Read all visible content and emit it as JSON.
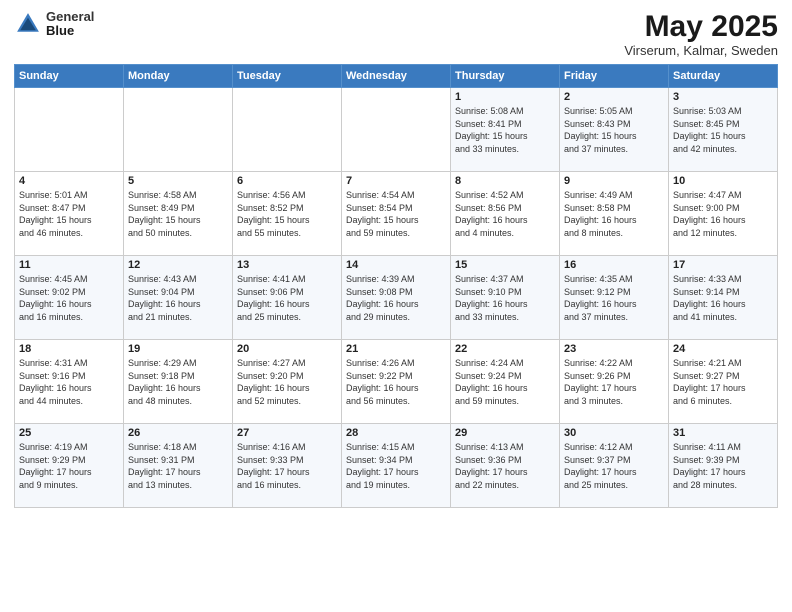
{
  "header": {
    "logo_line1": "General",
    "logo_line2": "Blue",
    "month": "May 2025",
    "location": "Virserum, Kalmar, Sweden"
  },
  "weekdays": [
    "Sunday",
    "Monday",
    "Tuesday",
    "Wednesday",
    "Thursday",
    "Friday",
    "Saturday"
  ],
  "weeks": [
    [
      {
        "day": "",
        "info": ""
      },
      {
        "day": "",
        "info": ""
      },
      {
        "day": "",
        "info": ""
      },
      {
        "day": "",
        "info": ""
      },
      {
        "day": "1",
        "info": "Sunrise: 5:08 AM\nSunset: 8:41 PM\nDaylight: 15 hours\nand 33 minutes."
      },
      {
        "day": "2",
        "info": "Sunrise: 5:05 AM\nSunset: 8:43 PM\nDaylight: 15 hours\nand 37 minutes."
      },
      {
        "day": "3",
        "info": "Sunrise: 5:03 AM\nSunset: 8:45 PM\nDaylight: 15 hours\nand 42 minutes."
      }
    ],
    [
      {
        "day": "4",
        "info": "Sunrise: 5:01 AM\nSunset: 8:47 PM\nDaylight: 15 hours\nand 46 minutes."
      },
      {
        "day": "5",
        "info": "Sunrise: 4:58 AM\nSunset: 8:49 PM\nDaylight: 15 hours\nand 50 minutes."
      },
      {
        "day": "6",
        "info": "Sunrise: 4:56 AM\nSunset: 8:52 PM\nDaylight: 15 hours\nand 55 minutes."
      },
      {
        "day": "7",
        "info": "Sunrise: 4:54 AM\nSunset: 8:54 PM\nDaylight: 15 hours\nand 59 minutes."
      },
      {
        "day": "8",
        "info": "Sunrise: 4:52 AM\nSunset: 8:56 PM\nDaylight: 16 hours\nand 4 minutes."
      },
      {
        "day": "9",
        "info": "Sunrise: 4:49 AM\nSunset: 8:58 PM\nDaylight: 16 hours\nand 8 minutes."
      },
      {
        "day": "10",
        "info": "Sunrise: 4:47 AM\nSunset: 9:00 PM\nDaylight: 16 hours\nand 12 minutes."
      }
    ],
    [
      {
        "day": "11",
        "info": "Sunrise: 4:45 AM\nSunset: 9:02 PM\nDaylight: 16 hours\nand 16 minutes."
      },
      {
        "day": "12",
        "info": "Sunrise: 4:43 AM\nSunset: 9:04 PM\nDaylight: 16 hours\nand 21 minutes."
      },
      {
        "day": "13",
        "info": "Sunrise: 4:41 AM\nSunset: 9:06 PM\nDaylight: 16 hours\nand 25 minutes."
      },
      {
        "day": "14",
        "info": "Sunrise: 4:39 AM\nSunset: 9:08 PM\nDaylight: 16 hours\nand 29 minutes."
      },
      {
        "day": "15",
        "info": "Sunrise: 4:37 AM\nSunset: 9:10 PM\nDaylight: 16 hours\nand 33 minutes."
      },
      {
        "day": "16",
        "info": "Sunrise: 4:35 AM\nSunset: 9:12 PM\nDaylight: 16 hours\nand 37 minutes."
      },
      {
        "day": "17",
        "info": "Sunrise: 4:33 AM\nSunset: 9:14 PM\nDaylight: 16 hours\nand 41 minutes."
      }
    ],
    [
      {
        "day": "18",
        "info": "Sunrise: 4:31 AM\nSunset: 9:16 PM\nDaylight: 16 hours\nand 44 minutes."
      },
      {
        "day": "19",
        "info": "Sunrise: 4:29 AM\nSunset: 9:18 PM\nDaylight: 16 hours\nand 48 minutes."
      },
      {
        "day": "20",
        "info": "Sunrise: 4:27 AM\nSunset: 9:20 PM\nDaylight: 16 hours\nand 52 minutes."
      },
      {
        "day": "21",
        "info": "Sunrise: 4:26 AM\nSunset: 9:22 PM\nDaylight: 16 hours\nand 56 minutes."
      },
      {
        "day": "22",
        "info": "Sunrise: 4:24 AM\nSunset: 9:24 PM\nDaylight: 16 hours\nand 59 minutes."
      },
      {
        "day": "23",
        "info": "Sunrise: 4:22 AM\nSunset: 9:26 PM\nDaylight: 17 hours\nand 3 minutes."
      },
      {
        "day": "24",
        "info": "Sunrise: 4:21 AM\nSunset: 9:27 PM\nDaylight: 17 hours\nand 6 minutes."
      }
    ],
    [
      {
        "day": "25",
        "info": "Sunrise: 4:19 AM\nSunset: 9:29 PM\nDaylight: 17 hours\nand 9 minutes."
      },
      {
        "day": "26",
        "info": "Sunrise: 4:18 AM\nSunset: 9:31 PM\nDaylight: 17 hours\nand 13 minutes."
      },
      {
        "day": "27",
        "info": "Sunrise: 4:16 AM\nSunset: 9:33 PM\nDaylight: 17 hours\nand 16 minutes."
      },
      {
        "day": "28",
        "info": "Sunrise: 4:15 AM\nSunset: 9:34 PM\nDaylight: 17 hours\nand 19 minutes."
      },
      {
        "day": "29",
        "info": "Sunrise: 4:13 AM\nSunset: 9:36 PM\nDaylight: 17 hours\nand 22 minutes."
      },
      {
        "day": "30",
        "info": "Sunrise: 4:12 AM\nSunset: 9:37 PM\nDaylight: 17 hours\nand 25 minutes."
      },
      {
        "day": "31",
        "info": "Sunrise: 4:11 AM\nSunset: 9:39 PM\nDaylight: 17 hours\nand 28 minutes."
      }
    ]
  ]
}
